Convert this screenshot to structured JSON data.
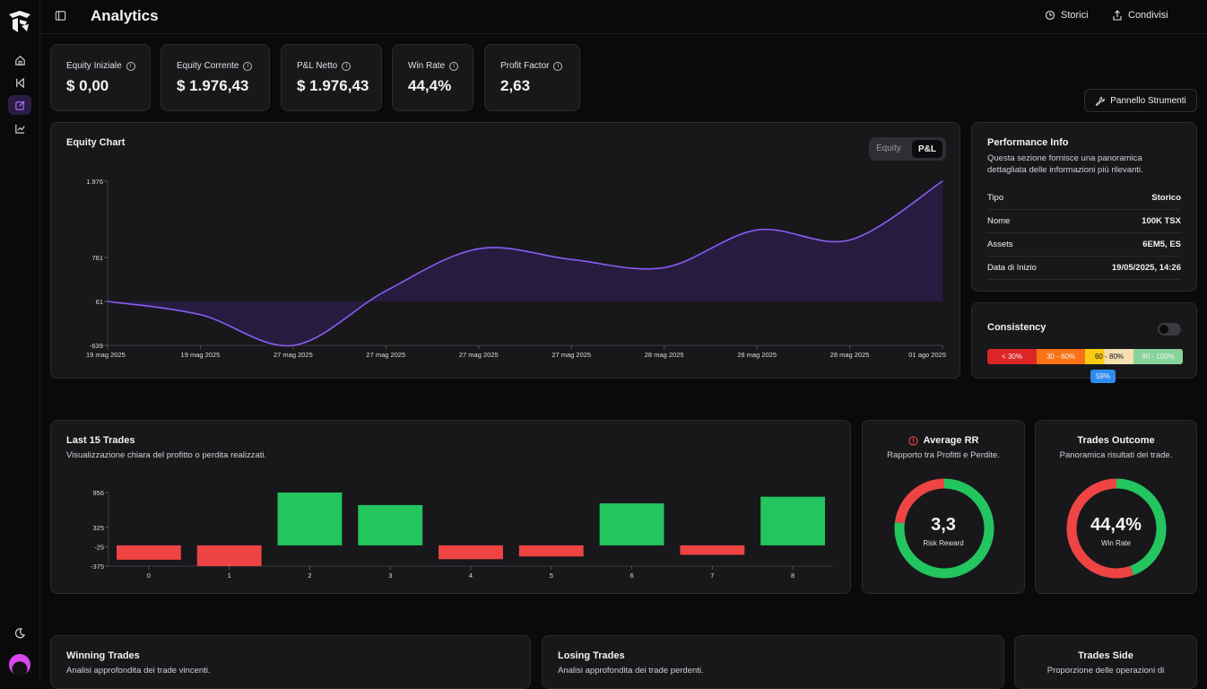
{
  "app": {
    "title": "Analytics"
  },
  "header": {
    "storici_label": "Storici",
    "condivisi_label": "Condivisi"
  },
  "stats": [
    {
      "label": "Equity Iniziale",
      "value": "$ 0,00"
    },
    {
      "label": "Equity Corrente",
      "value": "$ 1.976,43"
    },
    {
      "label": "P&L Netto",
      "value": "$ 1.976,43"
    },
    {
      "label": "Win Rate",
      "value": "44,4%"
    },
    {
      "label": "Profit Factor",
      "value": "2,63"
    }
  ],
  "tools": {
    "label": "Pannello Strumenti"
  },
  "equity_chart": {
    "title": "Equity Chart",
    "toggle": {
      "equity": "Equity",
      "pnl": "P&L",
      "selected": "P&L"
    }
  },
  "performance": {
    "title": "Performance Info",
    "subtitle_line1": "Questa sezione fornisce una panoramica",
    "subtitle_line2": "dettagliata delle informazioni più rilevanti.",
    "rows": [
      {
        "key": "Tipo",
        "value": "Storico"
      },
      {
        "key": "Nome",
        "value": "100K TSX"
      },
      {
        "key": "Assets",
        "value": "6EM5, ES"
      },
      {
        "key": "Data di Inizio",
        "value": "19/05/2025, 14:26"
      }
    ]
  },
  "consistency": {
    "title": "Consistency",
    "segments": [
      {
        "label": "< 30%",
        "color": "#dc2626"
      },
      {
        "label": "30 - 60%",
        "color": "#f97316"
      },
      {
        "label": "60 - 80%",
        "color": "#facc15"
      },
      {
        "label": "80 - 100%",
        "color": "#86d49a"
      }
    ],
    "marker": "59%",
    "value": 59
  },
  "last_trades": {
    "title": "Last 15 Trades",
    "subtitle": "Visualizzazione chiara del profitto o perdita realizzati."
  },
  "average_rr": {
    "title": "Average RR",
    "subtitle": "Rapporto tra Profitti e Perdite.",
    "value": "3,3",
    "caption": "Risk Reward"
  },
  "trades_outcome": {
    "title": "Trades Outcome",
    "subtitle": "Panoramica risultati dei trade.",
    "value": "44,4%",
    "caption": "Win Rate"
  },
  "winning": {
    "title": "Winning Trades",
    "subtitle": "Analisi approfondita dei trade vincenti."
  },
  "losing": {
    "title": "Losing Trades",
    "subtitle": "Analisi approfondita dei trade perdenti."
  },
  "side": {
    "title": "Trades Side",
    "subtitle": "Proporzione delle operazioni di"
  },
  "chart_data": [
    {
      "type": "area",
      "title": "Equity Chart",
      "x": [
        "19 mag 2025",
        "19 mag 2025",
        "27 mag 2025",
        "27 mag 2025",
        "27 mag 2025",
        "27 mag 2025",
        "28 mag 2025",
        "28 mag 2025",
        "28 mag 2025",
        "01 ago 2025"
      ],
      "values": [
        61,
        -150,
        -639,
        230,
        900,
        730,
        600,
        1200,
        1040,
        1976
      ],
      "yticks": [
        "1.976",
        "761",
        "61",
        "-639"
      ],
      "ylim": [
        -639,
        1976
      ]
    },
    {
      "type": "bar",
      "title": "Last 15 Trades",
      "categories": [
        "0",
        "1",
        "2",
        "3",
        "4",
        "5",
        "6",
        "7",
        "8"
      ],
      "values": [
        -260,
        -375,
        956,
        730,
        -250,
        -200,
        760,
        -170,
        880
      ],
      "yticks": [
        "956",
        "325",
        "-25",
        "-375"
      ],
      "ylim": [
        -375,
        956
      ],
      "colors": {
        "positive": "#22c55e",
        "negative": "#ef4444"
      }
    },
    {
      "type": "pie",
      "title": "Average RR",
      "slices": [
        {
          "label": "Profit",
          "value": 77,
          "color": "#22c55e"
        },
        {
          "label": "Loss",
          "value": 23,
          "color": "#ef4444"
        }
      ]
    },
    {
      "type": "pie",
      "title": "Trades Outcome",
      "slices": [
        {
          "label": "Win",
          "value": 44.4,
          "color": "#22c55e"
        },
        {
          "label": "Loss",
          "value": 55.6,
          "color": "#ef4444"
        }
      ]
    }
  ]
}
